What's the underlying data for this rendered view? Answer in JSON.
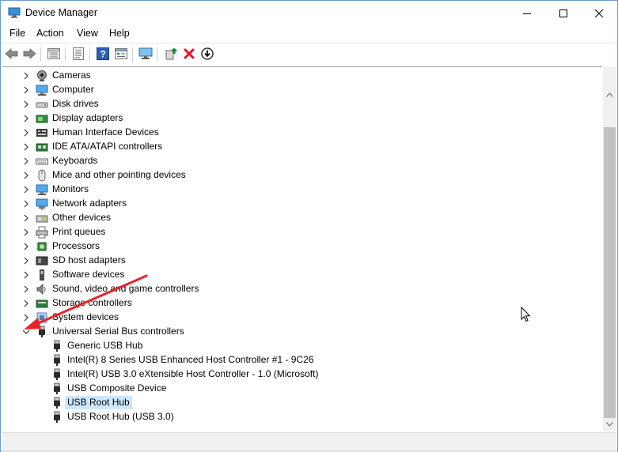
{
  "window": {
    "title": "Device Manager"
  },
  "window_buttons": [
    "minimize-icon",
    "maximize-icon",
    "close-icon"
  ],
  "menu": [
    "File",
    "Action",
    "View",
    "Help"
  ],
  "toolbar_icons": [
    "back-arrow-icon",
    "forward-arrow-icon",
    "properties-list-icon",
    "device-view-icon",
    "help-icon",
    "details-icon",
    "scan-monitor-icon",
    "update-driver-icon",
    "uninstall-x-icon",
    "download-driver-icon"
  ],
  "accent_colors": {
    "selection": "#cce8ff",
    "annotation_arrow": "#e8242a",
    "uninstall": "#e81123",
    "update": "#1a7f37"
  },
  "tree": {
    "categories": [
      {
        "label": "Cameras",
        "icon": "camera-icon",
        "expanded": false
      },
      {
        "label": "Computer",
        "icon": "computer-icon",
        "expanded": false
      },
      {
        "label": "Disk drives",
        "icon": "disk-drive-icon",
        "expanded": false
      },
      {
        "label": "Display adapters",
        "icon": "display-adapter-icon",
        "expanded": false
      },
      {
        "label": "Human Interface Devices",
        "icon": "hid-icon",
        "expanded": false
      },
      {
        "label": "IDE ATA/ATAPI controllers",
        "icon": "ide-controller-icon",
        "expanded": false
      },
      {
        "label": "Keyboards",
        "icon": "keyboard-icon",
        "expanded": false
      },
      {
        "label": "Mice and other pointing devices",
        "icon": "mouse-icon",
        "expanded": false
      },
      {
        "label": "Monitors",
        "icon": "monitor-icon",
        "expanded": false
      },
      {
        "label": "Network adapters",
        "icon": "network-adapter-icon",
        "expanded": false
      },
      {
        "label": "Other devices",
        "icon": "other-devices-icon",
        "expanded": false
      },
      {
        "label": "Print queues",
        "icon": "printer-icon",
        "expanded": false
      },
      {
        "label": "Processors",
        "icon": "processor-icon",
        "expanded": false
      },
      {
        "label": "SD host adapters",
        "icon": "sd-host-icon",
        "expanded": false
      },
      {
        "label": "Software devices",
        "icon": "software-device-icon",
        "expanded": false
      },
      {
        "label": "Sound, video and game controllers",
        "icon": "speaker-icon",
        "expanded": false
      },
      {
        "label": "Storage controllers",
        "icon": "storage-controller-icon",
        "expanded": false
      },
      {
        "label": "System devices",
        "icon": "system-device-icon",
        "expanded": false
      },
      {
        "label": "Universal Serial Bus controllers",
        "icon": "usb-icon",
        "expanded": true,
        "children": [
          {
            "label": "Generic USB Hub",
            "icon": "usb-icon",
            "selected": false
          },
          {
            "label": "Intel(R) 8 Series USB Enhanced Host Controller #1 - 9C26",
            "icon": "usb-icon",
            "selected": false
          },
          {
            "label": "Intel(R) USB 3.0 eXtensible Host Controller - 1.0 (Microsoft)",
            "icon": "usb-icon",
            "selected": false
          },
          {
            "label": "USB Composite Device",
            "icon": "usb-icon",
            "selected": false
          },
          {
            "label": "USB Root Hub",
            "icon": "usb-icon",
            "selected": true
          },
          {
            "label": "USB Root Hub (USB 3.0)",
            "icon": "usb-icon",
            "selected": false
          }
        ]
      }
    ]
  }
}
